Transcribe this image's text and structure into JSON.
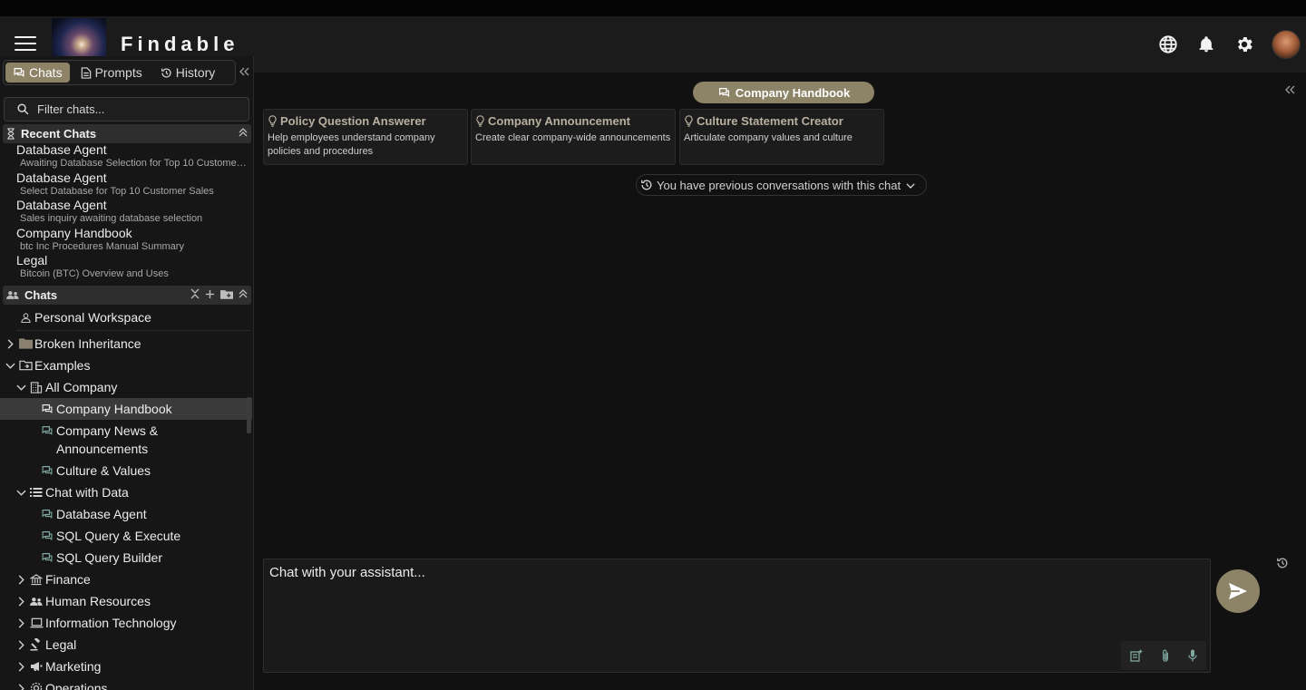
{
  "app": {
    "brand": "Findable"
  },
  "sidebar": {
    "tabs": [
      {
        "label": "Chats",
        "icon": "chat-icon"
      },
      {
        "label": "Prompts",
        "icon": "document-icon"
      },
      {
        "label": "History",
        "icon": "history-icon"
      }
    ],
    "filter": {
      "placeholder": "Filter chats..."
    },
    "recent": {
      "header": "Recent Chats",
      "items": [
        {
          "title": "Database Agent",
          "subtitle": "Awaiting Database Selection for Top 10 Customer Sales"
        },
        {
          "title": "Database Agent",
          "subtitle": "Select Database for Top 10 Customer Sales"
        },
        {
          "title": "Database Agent",
          "subtitle": "Sales inquiry awaiting database selection"
        },
        {
          "title": "Company Handbook",
          "subtitle": "btc Inc Procedures Manual Summary"
        },
        {
          "title": "Legal",
          "subtitle": "Bitcoin (BTC) Overview and Uses"
        }
      ]
    },
    "chats": {
      "header": "Chats",
      "personal_workspace": "Personal Workspace",
      "tree": {
        "broken_inheritance": "Broken Inheritance",
        "examples": "Examples",
        "all_company": "All Company",
        "company_handbook": "Company Handbook",
        "company_news": "Company News & Announcements",
        "culture_values": "Culture & Values",
        "chat_with_data": "Chat with Data",
        "database_agent": "Database Agent",
        "sql_query_execute": "SQL Query & Execute",
        "sql_query_builder": "SQL Query Builder",
        "finance": "Finance",
        "human_resources": "Human Resources",
        "information_technology": "Information Technology",
        "legal": "Legal",
        "marketing": "Marketing",
        "operations": "Operations"
      }
    }
  },
  "main": {
    "chat_title": "Company Handbook",
    "prompts": [
      {
        "title": "Policy Question Answerer",
        "description": "Help employees understand company policies and procedures"
      },
      {
        "title": "Company Announcement",
        "description": "Create clear company-wide announcements"
      },
      {
        "title": "Culture Statement Creator",
        "description": "Articulate company values and culture"
      }
    ],
    "previous_conversations": "You have previous conversations with this chat",
    "composer": {
      "placeholder": "Chat with your assistant..."
    }
  },
  "colors": {
    "accent": "#8d8367",
    "background": "#111111",
    "sidebar": "#161616"
  }
}
